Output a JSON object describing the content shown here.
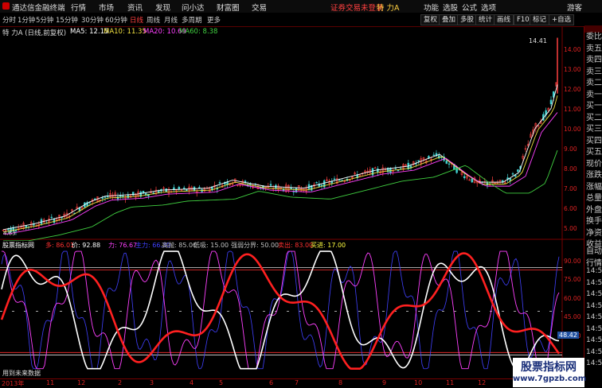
{
  "titlebar": {
    "app_name": "通达信金融终端",
    "menu": [
      "行情",
      "市场",
      "资讯",
      "发现",
      "问小达",
      "财富圈",
      "交易"
    ],
    "alert": "证券交易未登录",
    "stock_title": "特 力A",
    "right_menu": [
      "功能",
      "选股",
      "公式",
      "选项"
    ],
    "guest": "游客"
  },
  "periods": [
    "分时",
    "1分钟",
    "5分钟",
    "15分钟",
    "30分钟",
    "60分钟",
    "日线",
    "周线",
    "月线",
    "多周期",
    "更多"
  ],
  "active_period": "日线",
  "toolbar": [
    "复权",
    "叠加",
    "多股",
    "统计",
    "画线",
    "F10",
    "标记",
    "+自选"
  ],
  "price_panel": {
    "header": "特 力A (日线,前复权)",
    "ma": [
      {
        "label": "MA5: 12.15",
        "color": "#ffffff"
      },
      {
        "label": "MA10: 11.35",
        "color": "#f0e040"
      },
      {
        "label": "MA20: 10.69",
        "color": "#ff40ff"
      },
      {
        "label": "MA60: 8.38",
        "color": "#40d040"
      }
    ],
    "last_price": "14.41",
    "y_ticks": [
      "14.00",
      "13.00",
      "12.00",
      "11.00",
      "10.00",
      "9.00",
      "8.00",
      "7.00",
      "6.00",
      "5.00"
    ],
    "y_min": 4.6,
    "y_max": 14.7,
    "low_label": "4.63"
  },
  "indicator_panel": {
    "items": [
      {
        "label": "股票指标网",
        "color": "#ffffff"
      },
      {
        "label": "多: 86.01",
        "color": "#ff3030"
      },
      {
        "label": "价: 92.88",
        "color": "#ffffff"
      },
      {
        "label": "力: 76.67",
        "color": "#ff40ff"
      },
      {
        "label": "主力: 66.30",
        "color": "#4040ff"
      },
      {
        "label": "高抛: 85.00",
        "color": "#c0c0c0"
      },
      {
        "label": "低吸: 15.00",
        "color": "#c0c0c0"
      },
      {
        "label": "强弱分界: 50.00",
        "color": "#c0c0c0"
      },
      {
        "label": "卖出: 83.00",
        "color": "#ff3030"
      },
      {
        "label": "买进: 17.00",
        "color": "#ffff40"
      }
    ],
    "y_ticks": [
      "90.00",
      "75.00",
      "60.00",
      "45.00",
      "30.00"
    ],
    "current_value": "48.42",
    "footer": "用到未来数据"
  },
  "date_axis": [
    "2013年",
    "11",
    "12",
    "2",
    "3",
    "4",
    "5",
    "6",
    "7",
    "8",
    "9",
    "10",
    "11",
    "12",
    "2"
  ],
  "right_panel": [
    "委比",
    "卖五",
    "卖四",
    "卖三",
    "卖二",
    "卖一",
    "买一",
    "买二",
    "买三",
    "买四",
    "买五",
    "现价",
    "涨跌",
    "涨幅",
    "总量",
    "外盘",
    "换手",
    "净资",
    "收益"
  ],
  "right_panel_lower": [
    "自动",
    "行情",
    "14:5",
    "14:5",
    "14:5",
    "14:5",
    "14:5",
    "14:5",
    "14:5",
    "14:5",
    "14:5"
  ],
  "watermark": {
    "title": "股票指标网",
    "url": "www.7gpzb.com"
  }
}
